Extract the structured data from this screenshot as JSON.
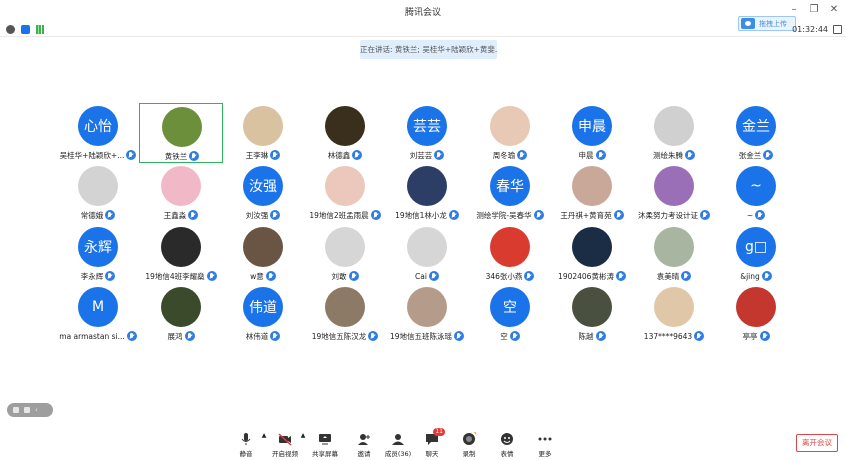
{
  "window": {
    "title": "腾讯会议",
    "cloud_upload": "拖拽上传"
  },
  "infobar": {
    "timer": "01:32:44"
  },
  "speaking_banner": "正在讲话: 黄铁兰; 吴桂华+陆颖欣+黄斐...",
  "participants": [
    {
      "name": "吴桂华+陆颖欣+...",
      "avatar_text": "心怡",
      "avatar_style": "blue"
    },
    {
      "name": "黄铁兰",
      "avatar_text": "",
      "avatar_style": "photo",
      "color": "#6b8f3a"
    },
    {
      "name": "王李琳",
      "avatar_text": "",
      "avatar_style": "photo",
      "color": "#d9c2a0"
    },
    {
      "name": "林德鑫",
      "avatar_text": "",
      "avatar_style": "photo",
      "color": "#3a2f1c"
    },
    {
      "name": "刘芸芸",
      "avatar_text": "芸芸",
      "avatar_style": "blue"
    },
    {
      "name": "周冬瑜",
      "avatar_text": "",
      "avatar_style": "photo",
      "color": "#e8c9b6"
    },
    {
      "name": "申晨",
      "avatar_text": "申晨",
      "avatar_style": "blue"
    },
    {
      "name": "测绘朱腾",
      "avatar_text": "",
      "avatar_style": "photo",
      "color": "#d0d0d0"
    },
    {
      "name": "张金兰",
      "avatar_text": "金兰",
      "avatar_style": "blue"
    },
    {
      "name": "常德娥",
      "avatar_text": "",
      "avatar_style": "photo",
      "color": "#d3d3d3"
    },
    {
      "name": "王鑫淼",
      "avatar_text": "",
      "avatar_style": "photo",
      "color": "#f1b9c8"
    },
    {
      "name": "刘汝强",
      "avatar_text": "汝强",
      "avatar_style": "blue"
    },
    {
      "name": "19地信2班孟雨晨",
      "avatar_text": "",
      "avatar_style": "photo",
      "color": "#ecc7bb"
    },
    {
      "name": "19地信1林小龙",
      "avatar_text": "",
      "avatar_style": "photo",
      "color": "#2c3e66"
    },
    {
      "name": "测绘学院-吴春华",
      "avatar_text": "春华",
      "avatar_style": "blue"
    },
    {
      "name": "王丹祺+黄育苑",
      "avatar_text": "",
      "avatar_style": "photo",
      "color": "#c9a89a"
    },
    {
      "name": "沐柔努力考设计证",
      "avatar_text": "",
      "avatar_style": "photo",
      "color": "#9b6fb8"
    },
    {
      "name": "~",
      "avatar_text": "~",
      "avatar_style": "blue"
    },
    {
      "name": "李永辉",
      "avatar_text": "永辉",
      "avatar_style": "blue"
    },
    {
      "name": "19地信4班李耀燊",
      "avatar_text": "",
      "avatar_style": "photo",
      "color": "#2a2a2a"
    },
    {
      "name": "w意",
      "avatar_text": "",
      "avatar_style": "photo",
      "color": "#6a5544"
    },
    {
      "name": "刘敢",
      "avatar_text": "",
      "avatar_style": "photo",
      "color": "#d6d6d6"
    },
    {
      "name": "Cai",
      "avatar_text": "",
      "avatar_style": "photo",
      "color": "#d6d6d6"
    },
    {
      "name": "346张小燕",
      "avatar_text": "",
      "avatar_style": "photo",
      "color": "#d93b2f"
    },
    {
      "name": "1902406黄彬涛",
      "avatar_text": "",
      "avatar_style": "photo",
      "color": "#1b2d45"
    },
    {
      "name": "袁美晴",
      "avatar_text": "",
      "avatar_style": "photo",
      "color": "#a8b5a0"
    },
    {
      "name": "&jing",
      "avatar_text": "g□",
      "avatar_style": "blue"
    },
    {
      "name": "ma armastan si...",
      "avatar_text": "M",
      "avatar_style": "blue"
    },
    {
      "name": "展鸿",
      "avatar_text": "",
      "avatar_style": "photo",
      "color": "#3a4a2a"
    },
    {
      "name": "林伟道",
      "avatar_text": "伟道",
      "avatar_style": "blue"
    },
    {
      "name": "19地信五陈汉龙",
      "avatar_text": "",
      "avatar_style": "photo",
      "color": "#8c7a66"
    },
    {
      "name": "19地信五班陈泳瑶",
      "avatar_text": "",
      "avatar_style": "photo",
      "color": "#b59b8a"
    },
    {
      "name": "空",
      "avatar_text": "空",
      "avatar_style": "blue"
    },
    {
      "name": "陈越",
      "avatar_text": "",
      "avatar_style": "photo",
      "color": "#4a5040"
    },
    {
      "name": "137****9643",
      "avatar_text": "",
      "avatar_style": "photo",
      "color": "#e0c7a8"
    },
    {
      "name": "亭亭",
      "avatar_text": "",
      "avatar_style": "photo",
      "color": "#c4372f"
    }
  ],
  "toolbar": {
    "mute": "静音",
    "video": "开启视频",
    "share": "共享屏幕",
    "invite": "邀请",
    "members": "成员(36)",
    "chat": "聊天",
    "chat_badge": "11",
    "record": "录制",
    "reaction": "表情",
    "more": "更多",
    "leave": "离开会议"
  },
  "colors": {
    "accent": "#1a73e8",
    "active_border": "#2db55d",
    "leave": "#e04646"
  }
}
